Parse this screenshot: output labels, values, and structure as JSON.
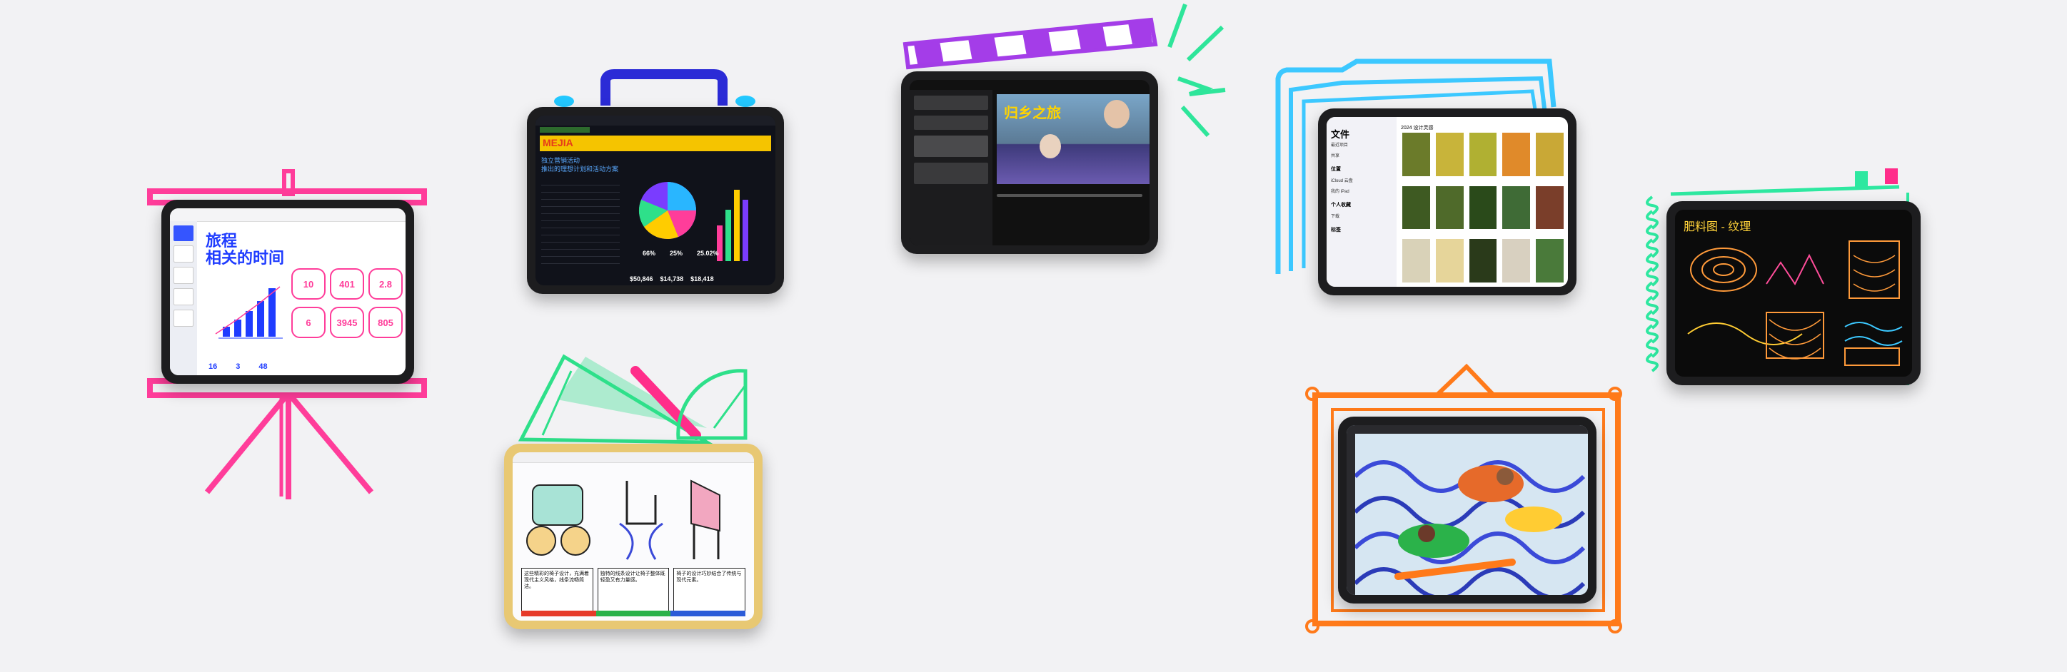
{
  "keynote": {
    "title_line1": "旅程",
    "title_line2": "相关的时间",
    "stats": [
      "10",
      "401",
      "2.8",
      "6",
      "3945",
      "805"
    ],
    "bottom_stats": [
      "16",
      "3",
      "48"
    ]
  },
  "numbers": {
    "brand": "MEJIA",
    "heading_line1": "独立营销活动",
    "heading_line2": "推出的理想计划和活动方案",
    "kpis": [
      "$50,846",
      "$14,738",
      "$18,418"
    ],
    "percents": [
      "66%",
      "25%",
      "25.02%"
    ]
  },
  "imovie": {
    "video_title": "归乡之旅"
  },
  "files": {
    "sidebar_title": "文件",
    "sidebar_items": [
      "最近项目",
      "共享",
      "位置",
      "iCloud 云盘",
      "我的 iPad",
      "个人收藏",
      "下载",
      "标签"
    ],
    "folder_title": "2024 设计灵感"
  },
  "notes": {
    "title": "肥料图 - 纹理"
  },
  "freeform": {
    "note1": "这些精彩的椅子设计，充满着现代主义风格，线条流畅简洁。",
    "note2": "独特的线条设计让椅子整体既轻盈又有力量感。",
    "note3": "椅子的设计巧妙结合了传统与现代元素。"
  },
  "colors": {
    "keynote_frame": "#ff3d9a",
    "numbers_handle": "#2b2bd6",
    "clapper": "#a43de8",
    "sparks": "#2ee59a",
    "folder": "#3cc8ff",
    "ruler": "#2ee08a",
    "frame": "#ff7a1a",
    "notes_spiral": "#2ee8a0"
  }
}
